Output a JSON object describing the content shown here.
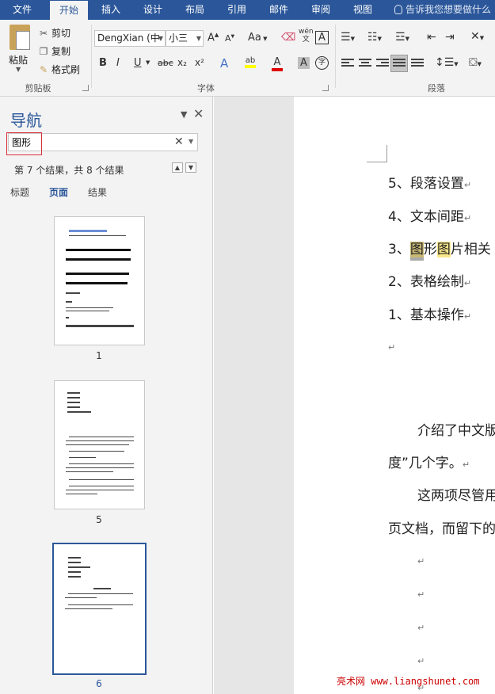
{
  "ribbon_tabs": [
    "文件",
    "开始",
    "插入",
    "设计",
    "布局",
    "引用",
    "邮件",
    "审阅",
    "视图"
  ],
  "tell_me": "告诉我您想要做什么",
  "clipboard": {
    "paste": "粘贴",
    "cut": "剪切",
    "copy": "复制",
    "format_painter": "格式刷",
    "group_label": "剪贴板"
  },
  "font": {
    "name": "DengXian (中",
    "size": "小三",
    "group_label": "字体",
    "change_case": "Aa",
    "phonetic": "wén",
    "bold": "B",
    "italic": "I",
    "underline": "U",
    "strike": "abc",
    "subscript": "x₂",
    "superscript": "x²"
  },
  "paragraph": {
    "group_label": "段落"
  },
  "navigation": {
    "title": "导航",
    "search_value": "图形",
    "result_text": "第 7 个结果，共 8 个结果",
    "tabs": [
      "标题",
      "页面",
      "结果"
    ],
    "active_tab": "页面",
    "pages": [
      "1",
      "5",
      "6"
    ],
    "selected_page": "6"
  },
  "document": {
    "lines": [
      {
        "text": "5、段落设置"
      },
      {
        "text": "4、文本间距"
      },
      {
        "prefix": "3、",
        "hit1": "图",
        "mid": "形",
        "hit2": "图",
        "rest": "片相关"
      },
      {
        "text": "2、表格绘制"
      },
      {
        "text": "1、基本操作"
      }
    ],
    "para1a": "介绍了中文版",
    "para1b": "度”几个字。",
    "para2a": "这两项尽管用",
    "para2b": "页文档，而留下的",
    "paragraph_mark": "↵"
  },
  "watermark": "亮术网 www.liangshunet.com"
}
